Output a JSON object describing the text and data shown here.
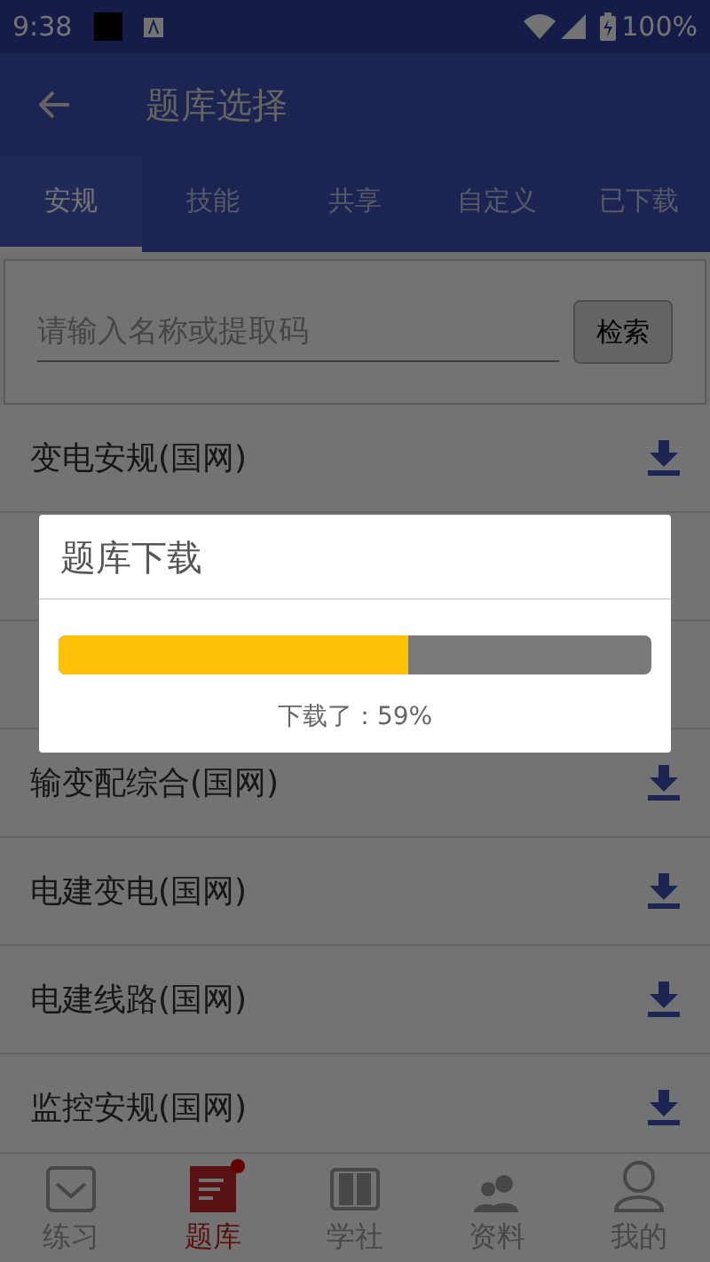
{
  "status_bar": {
    "time": "9:38",
    "battery": "100%"
  },
  "app_bar": {
    "title": "题库选择"
  },
  "tabs": [
    {
      "label": "安规",
      "selected": true
    },
    {
      "label": "技能",
      "selected": false
    },
    {
      "label": "共享",
      "selected": false
    },
    {
      "label": "自定义",
      "selected": false
    },
    {
      "label": "已下载",
      "selected": false
    }
  ],
  "search": {
    "placeholder": "请输入名称或提取码",
    "button": "检索"
  },
  "rows": [
    {
      "label": "变电安规(国网)"
    },
    {},
    {},
    {
      "label": "输变配综合(国网)"
    },
    {
      "label": "电建变电(国网)"
    },
    {
      "label": "电建线路(国网)"
    },
    {
      "label": "监控安规(国网)"
    }
  ],
  "bottom_nav": [
    {
      "label": "练习",
      "kind": "practice",
      "selected": false,
      "badge": false
    },
    {
      "label": "题库",
      "kind": "bank",
      "selected": true,
      "badge": true
    },
    {
      "label": "学社",
      "kind": "book",
      "selected": false,
      "badge": false
    },
    {
      "label": "资料",
      "kind": "people",
      "selected": false,
      "badge": false
    },
    {
      "label": "我的",
      "kind": "user",
      "selected": false,
      "badge": false
    }
  ],
  "dialog": {
    "title": "题库下载",
    "level": 0.59,
    "status": "下载了：59%"
  }
}
